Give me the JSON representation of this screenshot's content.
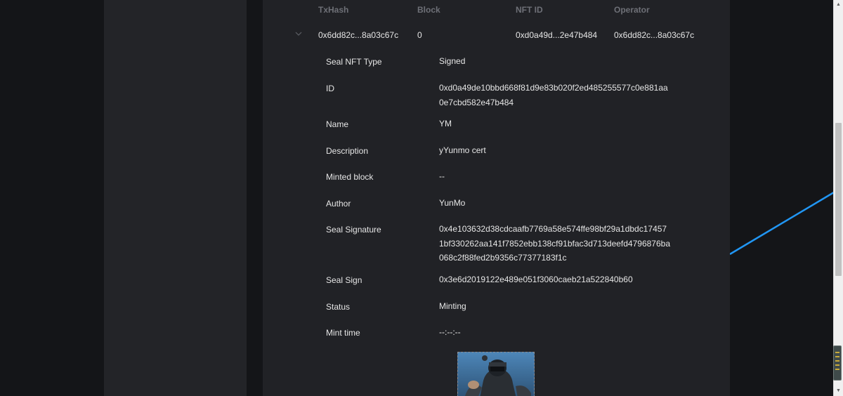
{
  "table": {
    "headers": [
      "TxHash",
      "Block",
      "NFT ID",
      "Operator"
    ],
    "row": {
      "txhash": "0x6dd82c...8a03c67c",
      "block": "0",
      "nft_id": "0xd0a49d...2e47b484",
      "operator": "0x6dd82c...8a03c67c"
    }
  },
  "details": [
    {
      "label": "Seal NFT Type",
      "value": "Signed"
    },
    {
      "label": "ID",
      "value": "0xd0a49de10bbd668f81d9e83b020f2ed485255577c0e881aa0e7cbd582e47b484"
    },
    {
      "label": "Name",
      "value": "YM"
    },
    {
      "label": "Description",
      "value": "yYunmo cert"
    },
    {
      "label": "Minted block",
      "value": "--"
    },
    {
      "label": "Author",
      "value": "YunMo"
    },
    {
      "label": "Seal Signature",
      "value": "0x4e103632d38cdcaafb7769a58e574ffe98bf29a1dbdc174571bf330262aa141f7852ebb138cf91bfac3d713deefd4796876ba068c2f88fed2b9356c77377183f1c"
    },
    {
      "label": "Seal Sign",
      "value": "0x3e6d2019122e489e051f3060caeb21a522840b60"
    },
    {
      "label": "Status",
      "value": "Minting"
    },
    {
      "label": "Mint time",
      "value": "--:--:--"
    }
  ],
  "icons": {
    "expand": "chevron-down-icon"
  },
  "colors": {
    "background": "#141518",
    "panel": "#232428",
    "main_panel": "#212226",
    "header_text": "#6e7077",
    "text": "#e6e6e6",
    "accent_line": "#2196f3"
  }
}
